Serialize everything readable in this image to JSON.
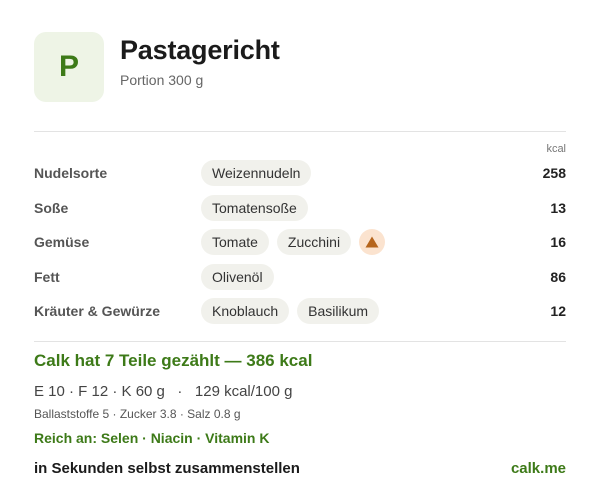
{
  "header": {
    "logo_letter": "P",
    "title": "Pastagericht",
    "subtitle": "Portion 300 g"
  },
  "table": {
    "unit_header": "kcal",
    "rows": [
      {
        "label": "Nudelsorte",
        "chips": [
          "Weizennudeln"
        ],
        "kcal": "258"
      },
      {
        "label": "Soße",
        "chips": [
          "Tomatensoße"
        ],
        "kcal": "13"
      },
      {
        "label": "Gemüse",
        "chips": [
          "Tomate",
          "Zucchini"
        ],
        "warning_icon": "warning-triangle-icon",
        "kcal": "16"
      },
      {
        "label": "Fett",
        "chips": [
          "Olivenöl"
        ],
        "kcal": "86"
      },
      {
        "label": "Kräuter & Gewürze",
        "chips": [
          "Knoblauch",
          "Basilikum"
        ],
        "kcal": "12"
      }
    ]
  },
  "summary": {
    "headline": "Calk hat 7 Teile gezählt — 386 kcal",
    "macros": "E 10 · F 12 · K 60 g   ·   129 kcal/100 g",
    "micros": "Ballaststoffe 5 · Zucker 3.8 · Salz 0.8 g",
    "rich_in": "Reich an: Selen · Niacin · Vitamin K"
  },
  "footer": {
    "cta": "in Sekunden selbst zusammenstellen",
    "site": "calk.me"
  },
  "colors": {
    "accent_green": "#3d7a18",
    "logo_bg": "#eef4e6",
    "chip_bg": "#f1f1ec",
    "warning_bg": "#fbe3cf",
    "warning_icon": "#b5651d"
  }
}
